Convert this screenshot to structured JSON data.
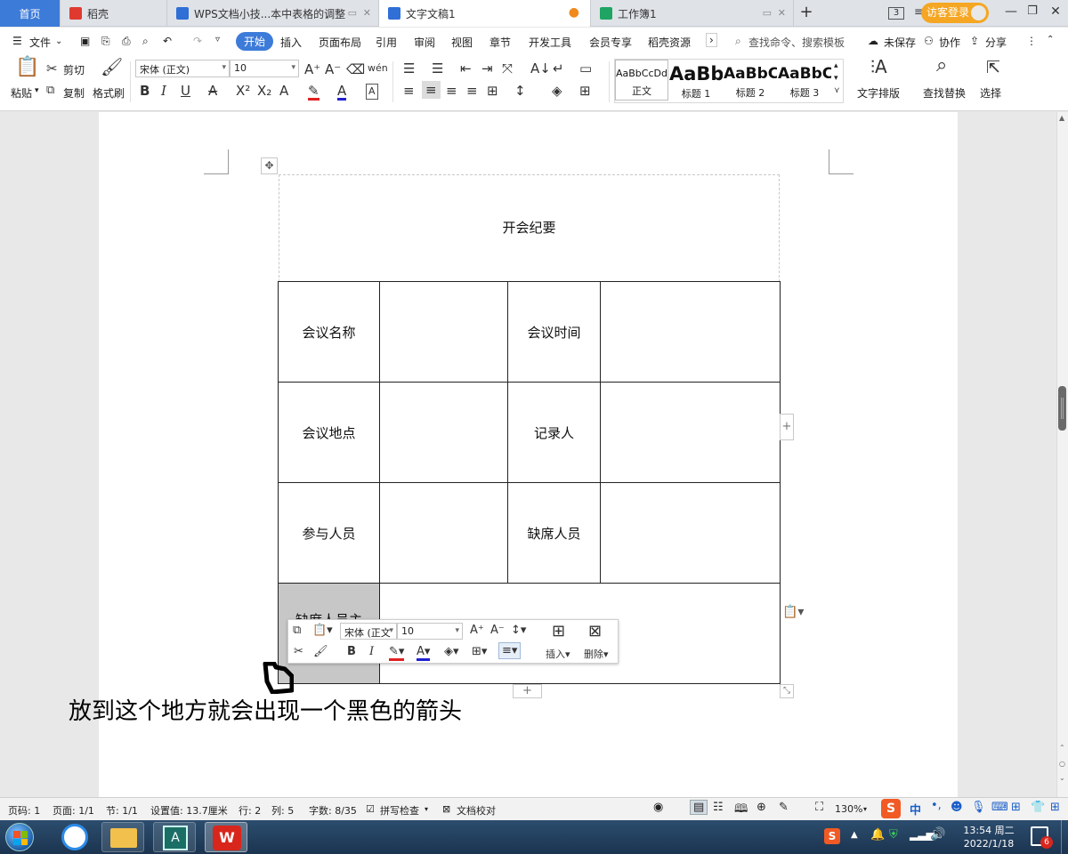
{
  "tabs": [
    {
      "label": "首页",
      "icon": "home"
    },
    {
      "label": "稻壳",
      "icon": "daoke-logo-icon"
    },
    {
      "label": "WPS文档小技...本中表格的调整",
      "icon": "wps-writer-icon"
    },
    {
      "label": "文字文稿1",
      "icon": "wps-writer-icon",
      "active": true
    },
    {
      "label": "工作簿1",
      "icon": "wps-sheet-icon"
    }
  ],
  "titlebar": {
    "page_count": "3",
    "visitor_login": "访客登录"
  },
  "menu": {
    "file": "文件",
    "items": [
      "开始",
      "插入",
      "页面布局",
      "引用",
      "审阅",
      "视图",
      "章节",
      "开发工具",
      "会员专享",
      "稻壳资源"
    ],
    "search_placeholder": "查找命令、搜索模板",
    "unsaved": "未保存",
    "collab": "协作",
    "share": "分享"
  },
  "ribbon": {
    "paste": "粘贴",
    "cut": "剪切",
    "copy": "复制",
    "format_painter": "格式刷",
    "font_name": "宋体 (正文)",
    "font_size": "10",
    "styles": [
      {
        "preview": "AaBbCcDd",
        "label": "正文"
      },
      {
        "preview": "AaBb",
        "label": "标题 1"
      },
      {
        "preview": "AaBbC",
        "label": "标题 2"
      },
      {
        "preview": "AaBbC",
        "label": "标题 3"
      }
    ],
    "text_layout": "文字排版",
    "find_replace": "查找替换",
    "select": "选择"
  },
  "document": {
    "title": "开会纪要",
    "rows": [
      [
        "会议名称",
        "",
        "会议时间",
        ""
      ],
      [
        "会议地点",
        "",
        "记录人",
        ""
      ],
      [
        "参与人员",
        "",
        "缺席人员",
        ""
      ]
    ],
    "last_row_label": "缺席人员主",
    "caption": "放到这个地方就会出现一个黑色的箭头"
  },
  "mini_toolbar": {
    "font_name": "宋体 (正文",
    "font_size": "10",
    "insert": "插入",
    "delete": "删除"
  },
  "statusbar": {
    "page": "页码: 1",
    "pages": "页面: 1/1",
    "section": "节: 1/1",
    "setting": "设置值: 13.7厘米",
    "row": "行: 2",
    "col": "列: 5",
    "words": "字数: 8/35",
    "spell": "拼写检查",
    "proof": "文档校对",
    "zoom": "130%"
  },
  "taskbar": {
    "ime": "中",
    "time": "13:54 周二",
    "date": "2022/1/18",
    "notif_count": "6"
  },
  "colors": {
    "accent": "#3d7bd9",
    "login": "#f5a623",
    "wps_red": "#d9261c",
    "sheet_green": "#1fa463"
  }
}
